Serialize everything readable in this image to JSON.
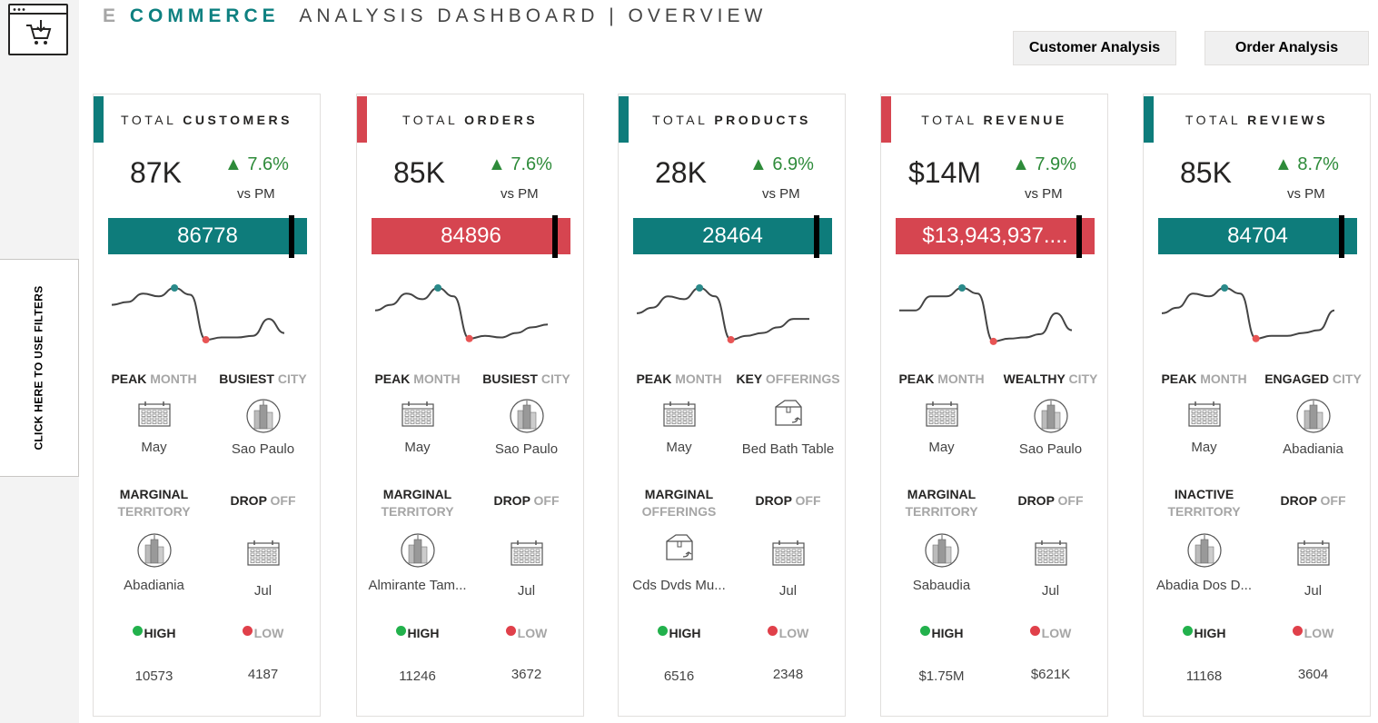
{
  "header": {
    "title_e": "E ",
    "title_commerce": "COMMERCE",
    "title_rest": "ANALYSIS DASHBOARD | OVERVIEW",
    "btn_customer": "Customer Analysis",
    "btn_order": "Order Analysis"
  },
  "sidebar": {
    "filter_label": "CLICK HERE TO USE FILTERS",
    "logo_icon": "cart-download-icon"
  },
  "colors": {
    "teal": "#0e7c7b",
    "red": "#d64550",
    "green": "#2e8b3a",
    "dot_green": "#22b14c",
    "dot_red": "#e0404a"
  },
  "cards": [
    {
      "title_pre": "TOTAL ",
      "title_bold": "CUSTOMERS",
      "accent": "teal",
      "big": "87K",
      "change": "▲ 7.6%",
      "vs": "vs PM",
      "bar_value": "86778",
      "spark": [
        0.3,
        0.25,
        0.1,
        0.15,
        0.0,
        0.12,
        0.92,
        0.88,
        0.88,
        0.85,
        0.55,
        0.8
      ],
      "peak_idx": 4,
      "low_idx": 6,
      "l1a": "PEAK ",
      "l1b": "MONTH",
      "l2a": "BUSIEST ",
      "l2b": "CITY",
      "v1": "May",
      "v2": "Sao Paulo",
      "l3a": "MARGINAL",
      "l3b": "TERRITORY",
      "l4a": "DROP ",
      "l4b": "OFF",
      "v3": "Abadiania",
      "v4": "Jul",
      "high_label": "HIGH",
      "low_label": "LOW",
      "high": "10573",
      "low": "4187",
      "icons": [
        "calendar-icon",
        "city-icon",
        "city-icon",
        "calendar-icon"
      ]
    },
    {
      "title_pre": "TOTAL ",
      "title_bold": "ORDERS",
      "accent": "red",
      "big": "85K",
      "change": "▲ 7.6%",
      "vs": "vs PM",
      "bar_value": "84896",
      "spark": [
        0.4,
        0.3,
        0.1,
        0.2,
        0.0,
        0.15,
        0.9,
        0.85,
        0.88,
        0.8,
        0.7,
        0.65
      ],
      "peak_idx": 4,
      "low_idx": 6,
      "l1a": "PEAK ",
      "l1b": "MONTH",
      "l2a": "BUSIEST ",
      "l2b": "CITY",
      "v1": "May",
      "v2": "Sao Paulo",
      "l3a": "MARGINAL",
      "l3b": "TERRITORY",
      "l4a": "DROP ",
      "l4b": "OFF",
      "v3": "Almirante Tam...",
      "v4": "Jul",
      "high_label": "HIGH",
      "low_label": "LOW",
      "high": "11246",
      "low": "3672",
      "icons": [
        "calendar-icon",
        "city-icon",
        "city-icon",
        "calendar-icon"
      ]
    },
    {
      "title_pre": "TOTAL ",
      "title_bold": "PRODUCTS",
      "accent": "teal",
      "big": "28K",
      "change": "▲ 6.9%",
      "vs": "vs PM",
      "bar_value": "28464",
      "spark": [
        0.45,
        0.35,
        0.15,
        0.2,
        0.0,
        0.15,
        0.92,
        0.85,
        0.8,
        0.7,
        0.55,
        0.55
      ],
      "peak_idx": 4,
      "low_idx": 6,
      "l1a": "PEAK ",
      "l1b": "MONTH",
      "l2a": "KEY ",
      "l2b": "OFFERINGS",
      "v1": "May",
      "v2": "Bed Bath Table",
      "l3a": "MARGINAL",
      "l3b": "OFFERINGS",
      "l4a": "DROP ",
      "l4b": "OFF",
      "v3": "Cds Dvds Mu...",
      "v4": "Jul",
      "high_label": "HIGH",
      "low_label": "LOW",
      "high": "6516",
      "low": "2348",
      "icons": [
        "calendar-icon",
        "box-return-icon",
        "box-return-icon",
        "calendar-icon"
      ]
    },
    {
      "title_pre": "TOTAL ",
      "title_bold": "REVENUE",
      "accent": "red",
      "big": "$14M",
      "change": "▲ 7.9%",
      "vs": "vs PM",
      "bar_value": "$13,943,937....",
      "spark": [
        0.4,
        0.4,
        0.15,
        0.15,
        0.0,
        0.1,
        0.95,
        0.9,
        0.88,
        0.82,
        0.45,
        0.75
      ],
      "peak_idx": 4,
      "low_idx": 6,
      "l1a": "PEAK ",
      "l1b": "MONTH",
      "l2a": "WEALTHY ",
      "l2b": "CITY",
      "v1": "May",
      "v2": "Sao Paulo",
      "l3a": "MARGINAL",
      "l3b": "TERRITORY",
      "l4a": "DROP ",
      "l4b": "OFF",
      "v3": "Sabaudia",
      "v4": "Jul",
      "high_label": "HIGH",
      "low_label": "LOW",
      "high": "$1.75M",
      "low": "$621K",
      "icons": [
        "calendar-icon",
        "city-icon",
        "city-icon",
        "calendar-icon"
      ]
    },
    {
      "title_pre": "TOTAL ",
      "title_bold": "REVIEWS",
      "accent": "teal",
      "big": "85K",
      "change": "▲ 8.7%",
      "vs": "vs PM",
      "bar_value": "84704",
      "spark": [
        0.45,
        0.35,
        0.1,
        0.15,
        0.0,
        0.1,
        0.9,
        0.85,
        0.85,
        0.8,
        0.75,
        0.4
      ],
      "peak_idx": 4,
      "low_idx": 6,
      "l1a": "PEAK ",
      "l1b": "MONTH",
      "l2a": "ENGAGED ",
      "l2b": "CITY",
      "v1": "May",
      "v2": "Abadiania",
      "l3a": "INACTIVE",
      "l3b": "TERRITORY",
      "l4a": "DROP ",
      "l4b": "OFF",
      "v3": "Abadia Dos D...",
      "v4": "Jul",
      "high_label": "HIGH",
      "low_label": "LOW",
      "high": "11168",
      "low": "3604",
      "icons": [
        "calendar-icon",
        "city-icon",
        "city-icon",
        "calendar-icon"
      ]
    }
  ]
}
